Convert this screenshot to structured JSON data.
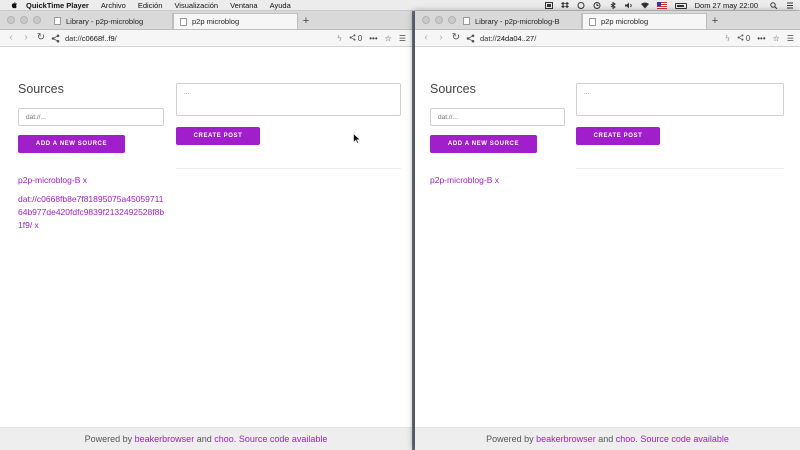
{
  "menubar": {
    "app": "QuickTime Player",
    "items": [
      "Archivo",
      "Edición",
      "Visualización",
      "Ventana",
      "Ayuda"
    ],
    "clock": "Dom 27 may  22:00"
  },
  "left": {
    "tabs": [
      "Library - p2p-microblog",
      "p2p microblog"
    ],
    "new_tab": "+",
    "url_prefix": "dat://",
    "url_host": "c0668f..f9",
    "url_suffix": "/",
    "share_count": "0",
    "sources_title": "Sources",
    "source_placeholder": "dat://...",
    "add_source_label": "ADD A NEW SOURCE",
    "post_placeholder": "...",
    "create_post_label": "CREATE POST",
    "sources": [
      "p2p-microblog-B x",
      "dat://c0668fb8e7f81895075a4505971164b977de420fdfc9839f2132492528f8b1f9/ x"
    ],
    "footer": {
      "prefix": "Powered by ",
      "link1": "beakerbrowser",
      "mid": " and ",
      "link2": "choo",
      "dot": ". ",
      "link3": "Source code available"
    }
  },
  "right": {
    "tabs": [
      "Library - p2p-microblog-B",
      "p2p microblog"
    ],
    "new_tab": "+",
    "url_prefix": "dat://",
    "url_host": "24da04..27",
    "url_suffix": "/",
    "share_count": "0",
    "sources_title": "Sources",
    "source_placeholder": "dat://...",
    "add_source_label": "ADD A NEW SOURCE",
    "post_placeholder": "...",
    "create_post_label": "CREATE POST",
    "sources": [
      "p2p-microblog-B x"
    ],
    "footer": {
      "prefix": "Powered by ",
      "link1": "beakerbrowser",
      "mid": " and ",
      "link2": "choo",
      "dot": ". ",
      "link3": "Source code available"
    }
  },
  "colors": {
    "accent": "#a01fca",
    "menubar": "#ececec",
    "desktop": "#5b6470"
  }
}
